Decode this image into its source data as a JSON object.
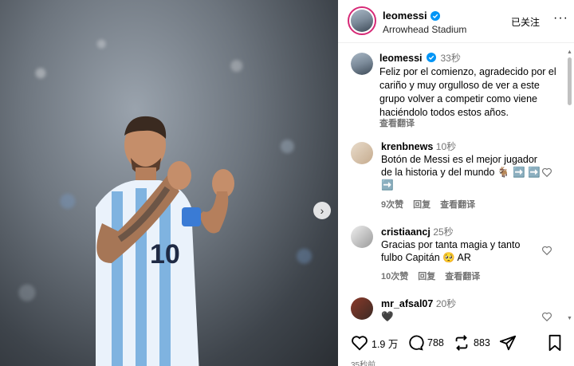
{
  "post": {
    "next_icon": "chevron-right-icon"
  },
  "header": {
    "username": "leomessi",
    "location": "Arrowhead Stadium",
    "follow_status": "已关注",
    "more": "···"
  },
  "caption": {
    "username": "leomessi",
    "time": "33秒",
    "text": "Feliz por el comienzo, agradecido por el cariño y muy orgulloso de ver a este grupo volver a competir como viene haciéndolo todos estos años.",
    "translate": "查看翻译"
  },
  "comments": [
    {
      "username": "krenbnews",
      "time": "10秒",
      "text": "Botón de Messi es el mejor jugador de la historia y del mundo 🐐 ➡️ ➡️ ➡️",
      "likes": "9次赞",
      "reply": "回复",
      "translate": "查看翻译"
    },
    {
      "username": "cristiaancj",
      "time": "25秒",
      "text": "Gracias por tanta magia y tanto fulbo Capitán 🥺 AR",
      "likes": "10次赞",
      "reply": "回复",
      "translate": "查看翻译"
    },
    {
      "username": "mr_afsal07",
      "time": "20秒",
      "text": "🖤"
    }
  ],
  "actions": {
    "likes": "1.9 万",
    "comments": "788",
    "reposts": "883"
  },
  "footer": {
    "time": "35秒前"
  },
  "colors": {
    "accent": "#0095f6",
    "secondary_text": "#737373"
  }
}
